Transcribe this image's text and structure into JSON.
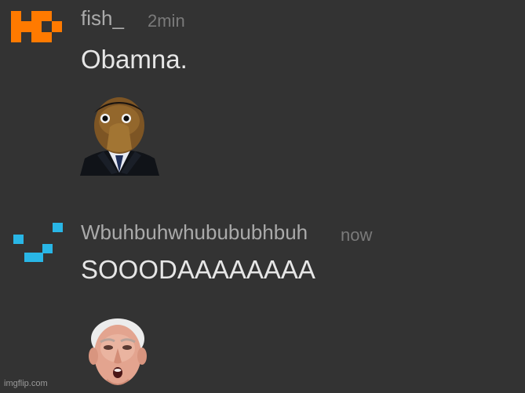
{
  "messages": [
    {
      "username": "fish_",
      "timestamp": "2min",
      "text": "Obamna.",
      "avatar_icon": "orange-pixel-logo-icon",
      "image": "obama-creepy-edit-image"
    },
    {
      "username": "Wbuhbuhwhubububhbuh",
      "timestamp": "now",
      "text": "SOOODAAAAAAAA",
      "avatar_icon": "cyan-pixel-squares-icon",
      "image": "biden-face-image"
    }
  ],
  "watermark": "imgflip.com",
  "colors": {
    "background": "#333333",
    "username": "#aaaaaa",
    "timestamp": "#7a7a7a",
    "message_text": "#e6e6e6",
    "avatar_orange": "#ff7a00",
    "avatar_cyan": "#29b6e6"
  }
}
